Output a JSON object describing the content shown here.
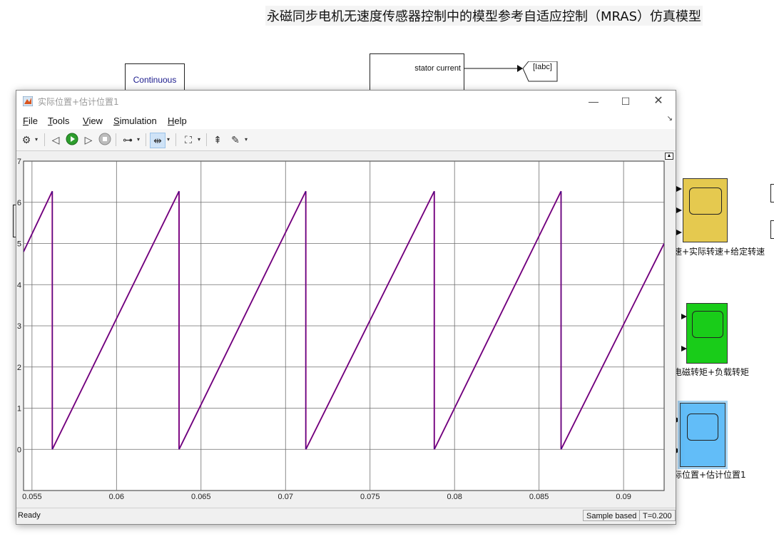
{
  "model": {
    "title": "永磁同步电机无速度传感器控制中的模型参考自适应控制（MRAS）仿真模型",
    "powergui_label": "Continuous",
    "stator_label": "stator current",
    "goto_tag": "[Iabc]",
    "scopes": [
      {
        "label": "速+实际转速+给定转速",
        "color": "#e5c94f"
      },
      {
        "label": "电磁转矩+负载转矩",
        "color": "#19cc19"
      },
      {
        "label": "际位置+估计位置1",
        "color": "#62bdf8"
      }
    ]
  },
  "window": {
    "title": "实际位置+估计位置1",
    "controls": {
      "minimize": "—",
      "maximize": "☐",
      "close": "✕"
    }
  },
  "menu": [
    "File",
    "Tools",
    "View",
    "Simulation",
    "Help"
  ],
  "toolbar": {
    "icons": [
      "settings-icon",
      "step-back-icon",
      "run-icon",
      "step-forward-icon",
      "stop-icon",
      "highlight-icon",
      "zoom-icon",
      "fit-to-view-icon",
      "cursor-measure-icon",
      "style-icon"
    ]
  },
  "status": {
    "ready": "Ready",
    "sample": "Sample based",
    "time": "T=0.200"
  },
  "chart_data": {
    "type": "line",
    "xlim": [
      0.0545,
      0.0924
    ],
    "ylim": [
      -1.0,
      7.0
    ],
    "xticks": [
      0.055,
      0.06,
      0.065,
      0.07,
      0.075,
      0.08,
      0.085,
      0.09
    ],
    "xtick_labels": [
      "0.055",
      "0.06",
      "0.065",
      "0.07",
      "0.075",
      "0.08",
      "0.085",
      "0.09"
    ],
    "yticks": [
      0,
      1,
      2,
      3,
      4,
      5,
      6,
      7
    ],
    "ytick_labels": [
      "0",
      "1",
      "2",
      "3",
      "4",
      "5",
      "6",
      "7"
    ],
    "grid": true,
    "series": [
      {
        "color": "#e6007e",
        "x": [
          0.0545,
          0.0562,
          0.0562,
          0.0637,
          0.0637,
          0.0712,
          0.0712,
          0.0788,
          0.0788,
          0.0863,
          0.0863,
          0.0924
        ],
        "y": [
          4.8,
          6.27,
          0.0,
          6.27,
          0.0,
          6.27,
          0.0,
          6.27,
          0.0,
          6.27,
          0.0,
          5.0
        ]
      },
      {
        "color": "#1a1a8c",
        "x": [
          0.0545,
          0.0562,
          0.0562,
          0.0637,
          0.0637,
          0.0712,
          0.0712,
          0.0788,
          0.0788,
          0.0863,
          0.0863,
          0.0924
        ],
        "y": [
          4.8,
          6.27,
          0.0,
          6.27,
          0.0,
          6.27,
          0.0,
          6.27,
          0.0,
          6.27,
          0.0,
          5.0
        ]
      }
    ]
  }
}
